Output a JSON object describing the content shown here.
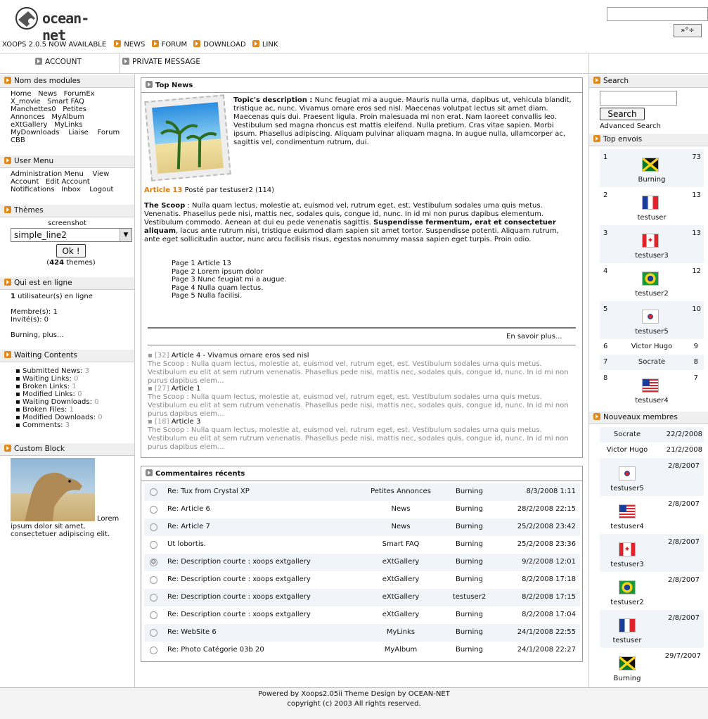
{
  "logo": {
    "text": "ocean-net"
  },
  "header": {
    "search_button": "»°÷"
  },
  "topnav": {
    "version": "XOOPS 2.0.5 NOW AVAILABLE",
    "items": [
      "NEWS",
      "FORUM",
      "DOWNLOAD",
      "LINK"
    ]
  },
  "subnav": {
    "account": "ACCOUNT",
    "pm": "PRIVATE MESSAGE"
  },
  "left": {
    "modules": {
      "title": "Nom des modules",
      "links": [
        "Home",
        "News",
        "ForumEx",
        "X_movie",
        "Smart FAQ",
        "Manchettes0",
        "Petites",
        "Annonces",
        "MyAlbum",
        "eXtGallery",
        "MyLinks",
        "MyDownloads",
        "Liaise",
        "Forum",
        "CBB"
      ]
    },
    "usermenu": {
      "title": "User Menu",
      "links": [
        "Administration Menu",
        "View",
        "Account",
        "Edit Account",
        "Notifications",
        "Inbox",
        "Logout"
      ]
    },
    "themes": {
      "title": "Thèmes",
      "label": "screenshot",
      "selected": "simple_line2",
      "button": "Ok !",
      "count": "424",
      "count_suffix": " themes)",
      "count_prefix": "("
    },
    "online": {
      "title": "Qui est en ligne",
      "count": "1",
      "count_text": " utilisateur(s) en ligne",
      "members": "Membre(s): 1",
      "guests": "Invité(s): 0",
      "list": "Burning, plus..."
    },
    "waiting": {
      "title": "Waiting Contents",
      "items": [
        {
          "label": "Submitted News:",
          "n": "3"
        },
        {
          "label": "Waiting Links:",
          "n": "0"
        },
        {
          "label": "Broken Links:",
          "n": "1"
        },
        {
          "label": "Modified Links:",
          "n": "0"
        },
        {
          "label": "Waiting Downloads:",
          "n": "0"
        },
        {
          "label": "Broken Files:",
          "n": "1"
        },
        {
          "label": "Modified Downloads:",
          "n": "0"
        },
        {
          "label": "Comments:",
          "n": "3"
        }
      ]
    },
    "custom": {
      "title": "Custom Block",
      "text1": "Lorem",
      "text2": "ipsum dolor sit amet,",
      "text3": "consectetuer adipiscing elit."
    }
  },
  "topnews": {
    "title": "Top News",
    "topic_label": "Topic's description :",
    "topic_text": "Nunc feugiat mi a augue. Mauris nulla urna, dapibus ut, vehicula blandit, tristique ac, nunc. Vivamus ornare eros sed nisl. Maecenas volutpat lectus sit amet diam. Maecenas quis dui. Praesent ligula. Proin malesuada mi non erat. Nam laoreet convallis leo. Vestibulum sed magna rhoncus est mattis eleifend. Nulla pretium. Cras vitae sapien. Morbi ipsum. Phasellus adipiscing. Aliquam pulvinar aliquam magna. In augue nulla, ullamcorper ac, sagittis vel, condimentum rutrum, dui.",
    "article_link": "Article 13",
    "posted": " Posté par testuser2 (114)",
    "scoop_label": "The Scoop",
    "scoop_a": " : Nulla quam lectus, molestie at, euismod vel, rutrum eget, est. Vestibulum sodales urna quis metus. Venenatis. Phasellus pede nisi, mattis nec, sodales quis, congue id, nunc. In id mi non purus dapibus elementum. Vestibulum commodo. Aenean at dui eu pede venenatis sagittis. ",
    "scoop_bold": "Suspendisse fermentum, erat et consectetuer aliquam",
    "scoop_b": ", lacus ante rutrum nisi, tristique euismod diam sapien sit amet tortor. Suspendisse potenti. Aliquam rutrum, ante eget sollicitudin auctor, nunc arcu facilisis risus, egestas nonummy massa sapien eget turpis. Proin odio.",
    "pages": [
      "Page 1 Article 13",
      "Page 2 Lorem ipsum dolor",
      "Page 3 Nunc feugiat mi a augue.",
      "Page 4 Nulla quam lectus.",
      "Page 5 Nulla facilisi."
    ],
    "readmore": "En savoir plus...",
    "others": [
      {
        "num": "[32]",
        "title": "Article 4 - Vivamus ornare eros sed nisl",
        "excerpt": "The Scoop : Nulla quam lectus, molestie at, euismod vel, rutrum eget, est. Vestibulum sodales urna quis metus. Vestibulum eu elit at sem rutrum venenatis. Phasellus pede nisi, mattis nec, sodales quis, congue id, nunc. In id mi non purus dapibus elem..."
      },
      {
        "num": "[27]",
        "title": "Article 1",
        "excerpt": "The Scoop : Nulla quam lectus, molestie at, euismod vel, rutrum eget, est. Vestibulum sodales urna quis metus. Vestibulum eu elit at sem rutrum venenatis. Phasellus pede nisi, mattis nec, sodales quis, congue id, nunc. In id mi non purus dapibus elem..."
      },
      {
        "num": "[18]",
        "title": "Article 3",
        "excerpt": "The Scoop : Nulla quam lectus, molestie at, euismod vel, rutrum eget, est. Vestibulum sodales urna quis metus. Vestibulum eu elit at sem rutrum venenatis. Phasellus pede nisi, mattis nec, sodales quis, congue id, nunc. In id mi non purus dapibus elem..."
      }
    ]
  },
  "comments": {
    "title": "Commentaires récents",
    "rows": [
      [
        "Re: Tux from Crystal XP",
        "Petites Annonces",
        "Burning",
        "8/3/2008 1:11"
      ],
      [
        "Re: Article 6",
        "News",
        "Burning",
        "28/2/2008 22:15"
      ],
      [
        "Re: Article 7",
        "News",
        "Burning",
        "25/2/2008 23:42"
      ],
      [
        "Ut lobortis.",
        "Smart FAQ",
        "Burning",
        "25/2/2008 23:36"
      ],
      [
        "Re: Description courte : xoops extgallery",
        "eXtGallery",
        "Burning",
        "9/2/2008 12:01"
      ],
      [
        "Re: Description courte : xoops extgallery",
        "eXtGallery",
        "Burning",
        "8/2/2008 17:18"
      ],
      [
        "Re: Description courte : xoops extgallery",
        "eXtGallery",
        "testuser2",
        "8/2/2008 17:15"
      ],
      [
        "Re: Description courte : xoops extgallery",
        "eXtGallery",
        "Burning",
        "8/2/2008 17:04"
      ],
      [
        "Re: WebSite 6",
        "MyLinks",
        "Burning",
        "24/1/2008 22:55"
      ],
      [
        "Re: Photo Catégorie 03b 20",
        "MyAlbum",
        "Burning",
        "24/1/2008 22:27"
      ]
    ]
  },
  "right": {
    "search": {
      "title": "Search",
      "button": "Search",
      "advanced": "Advanced Search"
    },
    "top": {
      "title": "Top envois",
      "rows": [
        {
          "rank": "1",
          "name": "Burning",
          "n": "73",
          "flag": "jamaica"
        },
        {
          "rank": "2",
          "name": "testuser",
          "n": "13",
          "flag": "france"
        },
        {
          "rank": "3",
          "name": "testuser3",
          "n": "13",
          "flag": "canada"
        },
        {
          "rank": "4",
          "name": "testuser2",
          "n": "12",
          "flag": "brazil"
        },
        {
          "rank": "5",
          "name": "testuser5",
          "n": "10",
          "flag": "korea"
        },
        {
          "rank": "6",
          "name": "Victor Hugo",
          "n": "9",
          "flag": ""
        },
        {
          "rank": "7",
          "name": "Socrate",
          "n": "8",
          "flag": ""
        },
        {
          "rank": "8",
          "name": "testuser4",
          "n": "7",
          "flag": "usa"
        }
      ]
    },
    "newmembers": {
      "title": "Nouveaux membres",
      "rows": [
        {
          "name": "Socrate",
          "date": "22/2/2008",
          "flag": ""
        },
        {
          "name": "Victor Hugo",
          "date": "21/2/2008",
          "flag": ""
        },
        {
          "name": "testuser5",
          "date": "2/8/2007",
          "flag": "korea"
        },
        {
          "name": "testuser4",
          "date": "2/8/2007",
          "flag": "usa"
        },
        {
          "name": "testuser3",
          "date": "2/8/2007",
          "flag": "canada"
        },
        {
          "name": "testuser2",
          "date": "2/8/2007",
          "flag": "brazil"
        },
        {
          "name": "testuser",
          "date": "2/8/2007",
          "flag": "france"
        },
        {
          "name": "Burning",
          "date": "29/7/2007",
          "flag": "jamaica"
        }
      ]
    }
  },
  "footer": {
    "line1": "Powered by Xoops2.05ii Theme Design by OCEAN-NET",
    "line2": "copyright (c) 2003 All rights reserved."
  }
}
